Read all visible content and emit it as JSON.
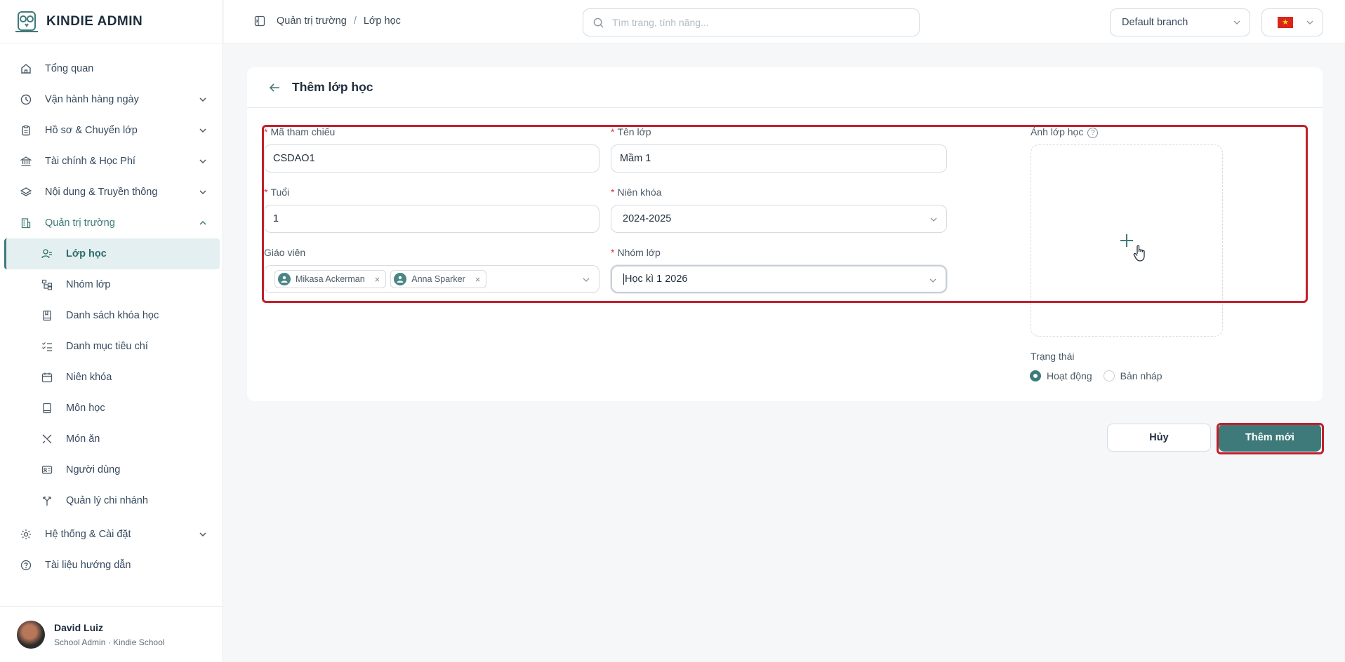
{
  "app": {
    "name": "KINDIE ADMIN"
  },
  "sidebar": {
    "items": [
      {
        "label": "Tổng quan",
        "icon": "home-icon"
      },
      {
        "label": "Vận hành hàng ngày",
        "icon": "clock-icon"
      },
      {
        "label": "Hồ sơ & Chuyển lớp",
        "icon": "clipboard-icon"
      },
      {
        "label": "Tài chính & Học Phí",
        "icon": "bank-icon"
      },
      {
        "label": "Nội dung & Truyền thông",
        "icon": "layers-icon"
      },
      {
        "label": "Quản trị trường",
        "icon": "building-icon"
      }
    ],
    "subitems": [
      {
        "label": "Lớp học",
        "icon": "user-class-icon"
      },
      {
        "label": "Nhóm lớp",
        "icon": "group-tree-icon"
      },
      {
        "label": "Danh sách khóa học",
        "icon": "book-list-icon"
      },
      {
        "label": "Danh mục tiêu chí",
        "icon": "checklist-icon"
      },
      {
        "label": "Niên khóa",
        "icon": "calendar-icon"
      },
      {
        "label": "Môn học",
        "icon": "book-icon"
      },
      {
        "label": "Món ăn",
        "icon": "utensils-icon"
      },
      {
        "label": "Người dùng",
        "icon": "id-card-icon"
      },
      {
        "label": "Quản lý chi nhánh",
        "icon": "branch-icon"
      }
    ],
    "bottom_items": [
      {
        "label": "Hệ thống & Cài đặt",
        "icon": "gear-icon"
      },
      {
        "label": "Tài liệu hướng dẫn",
        "icon": "help-icon"
      }
    ],
    "user": {
      "name": "David Luiz",
      "role": "School Admin · Kindie School"
    }
  },
  "topbar": {
    "breadcrumb": [
      "Quản trị trường",
      "Lớp học"
    ],
    "breadcrumb_sep": "/",
    "search_placeholder": "Tìm trang, tính năng...",
    "branch": "Default branch",
    "lang_flag": "★"
  },
  "form": {
    "title": "Thêm lớp học",
    "ref_label": "Mã tham chiếu",
    "ref_value": "CSDAO1",
    "name_label": "Tên lớp",
    "name_value": "Mầm 1",
    "age_label": "Tuổi",
    "age_value": "1",
    "year_label": "Niên khóa",
    "year_value": "2024-2025",
    "teacher_label": "Giáo viên",
    "teachers": [
      "Mikasa Ackerman",
      "Anna Sparker"
    ],
    "group_label": "Nhóm lớp",
    "group_value": "Học kì 1 2026",
    "image_label": "Ảnh lớp học",
    "help": "?",
    "status_label": "Trạng thái",
    "status_options": [
      "Hoạt động",
      "Bản nháp"
    ],
    "status_selected": "Hoạt động",
    "tag_remove": "×"
  },
  "actions": {
    "cancel": "Hủy",
    "submit": "Thêm mới"
  },
  "colors": {
    "accent": "#3f7a7a",
    "annotation": "#c0202c",
    "required": "#d9363e"
  }
}
